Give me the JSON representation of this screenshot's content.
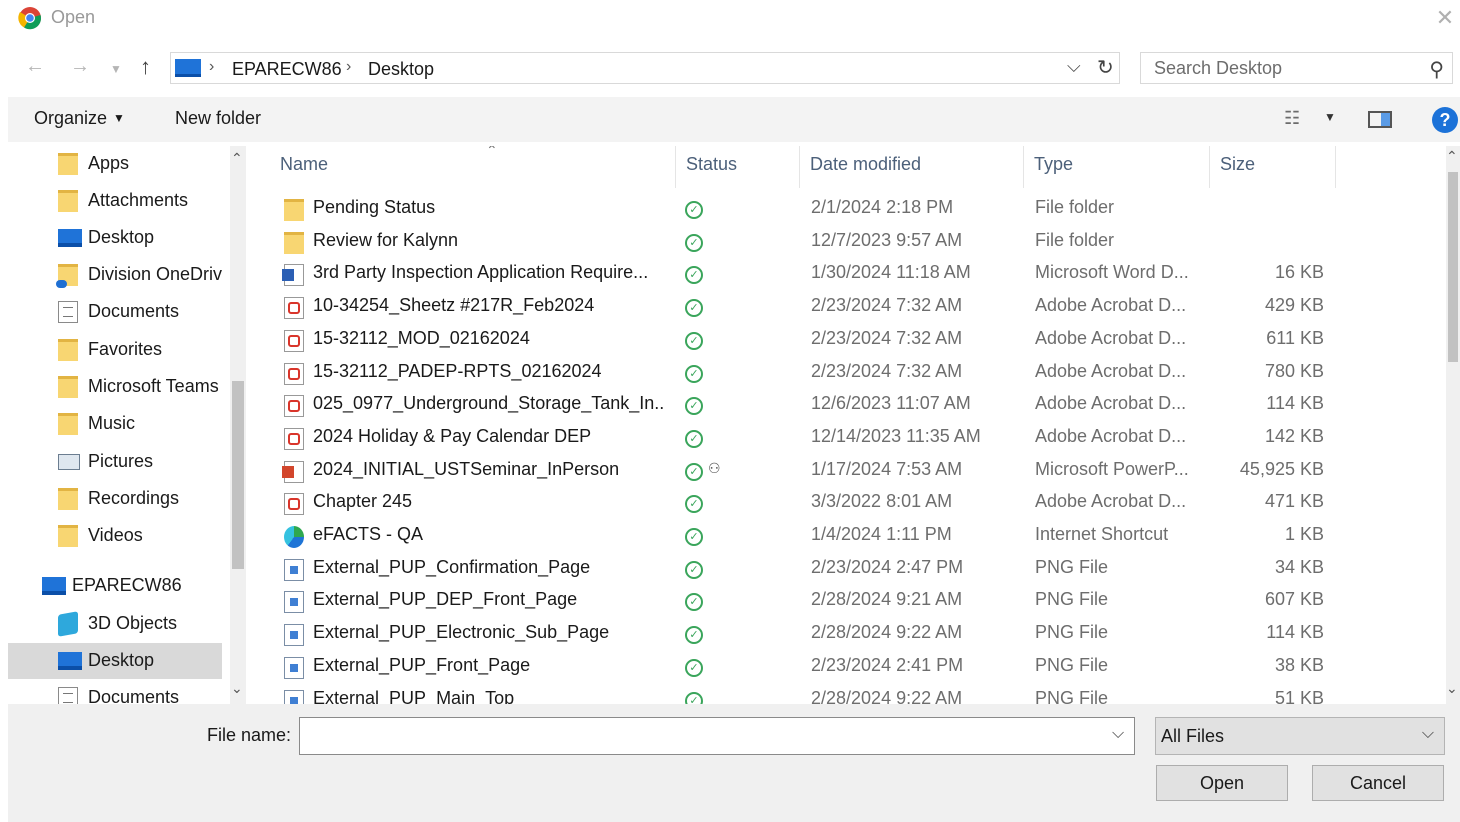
{
  "title": "Open",
  "icons": {
    "app": "chrome-icon",
    "close": "close-icon"
  },
  "nav": {
    "breadcrumbs": [
      "EPARECW86",
      "Desktop"
    ],
    "search_placeholder": "Search Desktop"
  },
  "toolbar": {
    "organize": "Organize",
    "new_folder": "New folder",
    "help": "?"
  },
  "navpane": {
    "items": [
      {
        "label": "Apps",
        "icon": "folder-icon"
      },
      {
        "label": "Attachments",
        "icon": "folder-icon"
      },
      {
        "label": "Desktop",
        "icon": "desktop-icon"
      },
      {
        "label": "Division OneDrive",
        "icon": "onedrive-folder-icon"
      },
      {
        "label": "Documents",
        "icon": "documents-icon"
      },
      {
        "label": "Favorites",
        "icon": "folder-icon"
      },
      {
        "label": "Microsoft Teams",
        "icon": "folder-icon"
      },
      {
        "label": "Music",
        "icon": "folder-icon"
      },
      {
        "label": "Pictures",
        "icon": "pictures-icon"
      },
      {
        "label": "Recordings",
        "icon": "folder-icon"
      },
      {
        "label": "Videos",
        "icon": "folder-icon"
      },
      {
        "label": "EPARECW86",
        "icon": "computer-icon"
      },
      {
        "label": "3D Objects",
        "icon": "3d-objects-icon"
      },
      {
        "label": "Desktop",
        "icon": "desktop-icon",
        "selected": true
      },
      {
        "label": "Documents",
        "icon": "documents-icon"
      }
    ]
  },
  "filelist": {
    "columns": [
      "Name",
      "Status",
      "Date modified",
      "Type",
      "Size"
    ],
    "rows": [
      {
        "name": "Pending Status",
        "date": "2/1/2024 2:18 PM",
        "type": "File folder",
        "size": "",
        "icon": "folder-icon"
      },
      {
        "name": "Review for Kalynn",
        "date": "12/7/2023 9:57 AM",
        "type": "File folder",
        "size": "",
        "icon": "folder-icon"
      },
      {
        "name": "3rd Party Inspection Application Require...",
        "date": "1/30/2024 11:18 AM",
        "type": "Microsoft Word D...",
        "size": "16 KB",
        "icon": "word-icon"
      },
      {
        "name": "10-34254_Sheetz #217R_Feb2024",
        "date": "2/23/2024 7:32 AM",
        "type": "Adobe Acrobat D...",
        "size": "429 KB",
        "icon": "pdf-icon"
      },
      {
        "name": "15-32112_MOD_02162024",
        "date": "2/23/2024 7:32 AM",
        "type": "Adobe Acrobat D...",
        "size": "611 KB",
        "icon": "pdf-icon"
      },
      {
        "name": "15-32112_PADEP-RPTS_02162024",
        "date": "2/23/2024 7:32 AM",
        "type": "Adobe Acrobat D...",
        "size": "780 KB",
        "icon": "pdf-icon"
      },
      {
        "name": "025_0977_Underground_Storage_Tank_In...",
        "date": "12/6/2023 11:07 AM",
        "type": "Adobe Acrobat D...",
        "size": "114 KB",
        "icon": "pdf-icon"
      },
      {
        "name": "2024 Holiday & Pay Calendar DEP",
        "date": "12/14/2023 11:35 AM",
        "type": "Adobe Acrobat D...",
        "size": "142 KB",
        "icon": "pdf-icon"
      },
      {
        "name": "2024_INITIAL_USTSeminar_InPerson",
        "date": "1/17/2024 7:53 AM",
        "type": "Microsoft PowerP...",
        "size": "45,925 KB",
        "icon": "powerpoint-icon",
        "shared": true
      },
      {
        "name": "Chapter 245",
        "date": "3/3/2022 8:01 AM",
        "type": "Adobe Acrobat D...",
        "size": "471 KB",
        "icon": "pdf-icon"
      },
      {
        "name": "eFACTS - QA",
        "date": "1/4/2024 1:11 PM",
        "type": "Internet Shortcut",
        "size": "1 KB",
        "icon": "web-shortcut-icon"
      },
      {
        "name": "External_PUP_Confirmation_Page",
        "date": "2/23/2024 2:47 PM",
        "type": "PNG File",
        "size": "34 KB",
        "icon": "png-icon"
      },
      {
        "name": "External_PUP_DEP_Front_Page",
        "date": "2/28/2024 9:21 AM",
        "type": "PNG File",
        "size": "607 KB",
        "icon": "png-icon"
      },
      {
        "name": "External_PUP_Electronic_Sub_Page",
        "date": "2/28/2024 9:22 AM",
        "type": "PNG File",
        "size": "114 KB",
        "icon": "png-icon"
      },
      {
        "name": "External_PUP_Front_Page",
        "date": "2/23/2024 2:41 PM",
        "type": "PNG File",
        "size": "38 KB",
        "icon": "png-icon"
      },
      {
        "name": "External_PUP_Main_Top",
        "date": "2/28/2024 9:22 AM",
        "type": "PNG File",
        "size": "51 KB",
        "icon": "png-icon"
      }
    ]
  },
  "bottom": {
    "file_name_label": "File name:",
    "file_name_value": "",
    "file_type": "All Files",
    "open": "Open",
    "cancel": "Cancel"
  },
  "colors": {
    "accent": "#1c72d8",
    "status_ok": "#3aa55b",
    "header_text": "#4c607a"
  }
}
